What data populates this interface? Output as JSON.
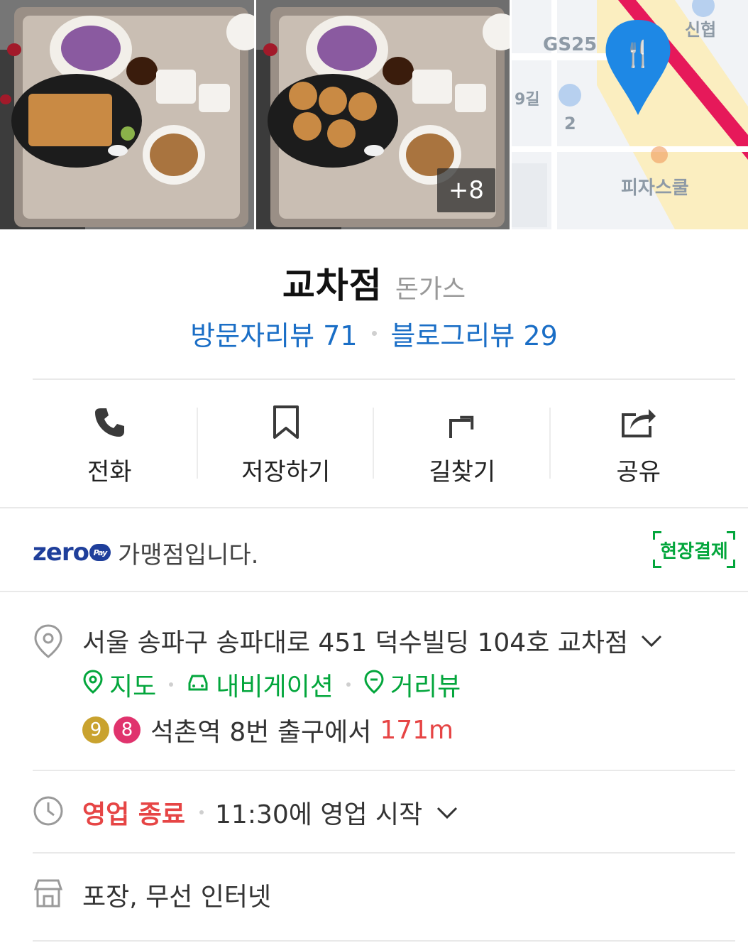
{
  "photos": {
    "more_count": "8",
    "more_prefix": "+",
    "map_labels": {
      "gs25": "GS25",
      "shinhyeop": "신협",
      "road": "9길",
      "parking_num": "2",
      "pizza_school": "피자스쿨"
    }
  },
  "place": {
    "name": "교차점",
    "category": "돈가스",
    "visitor_review_label": "방문자리뷰",
    "visitor_review_count": "71",
    "blog_review_label": "블로그리뷰",
    "blog_review_count": "29"
  },
  "actions": [
    {
      "label": "전화",
      "icon": "phone-icon"
    },
    {
      "label": "저장하기",
      "icon": "bookmark-icon"
    },
    {
      "label": "길찾기",
      "icon": "directions-icon"
    },
    {
      "label": "공유",
      "icon": "share-icon"
    }
  ],
  "zeropay": {
    "logo_text": "zero",
    "logo_pay": "Pay",
    "text": "가맹점입니다.",
    "badge": "현장결제"
  },
  "address": {
    "text": "서울 송파구 송파대로 451 덕수빌딩 104호 교차점",
    "links": [
      {
        "label": "지도",
        "icon": "map-pin-icon"
      },
      {
        "label": "내비게이션",
        "icon": "car-icon"
      },
      {
        "label": "거리뷰",
        "icon": "streetview-icon"
      }
    ],
    "subway": {
      "lines": [
        {
          "num": "9",
          "color": "#c9a22e"
        },
        {
          "num": "8",
          "color": "#e0336d"
        }
      ],
      "station": "석촌역",
      "exit": "8번 출구에서",
      "distance": "171m"
    }
  },
  "hours": {
    "status": "영업 종료",
    "next": "11:30에 영업 시작"
  },
  "amenities": {
    "text": "포장, 무선 인터넷"
  },
  "colors": {
    "brand_blue": "#1a6ec6",
    "green": "#03a63c",
    "red": "#e64545"
  }
}
